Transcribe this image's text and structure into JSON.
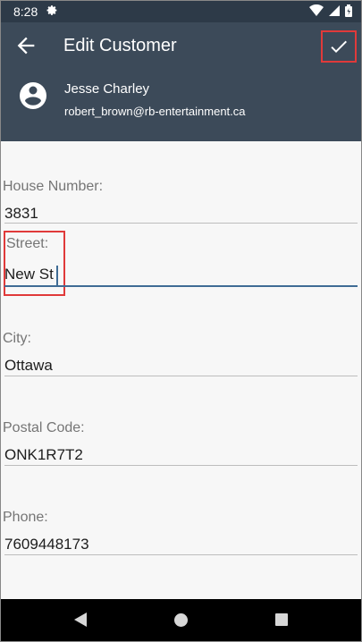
{
  "status_bar": {
    "time": "8:28"
  },
  "toolbar": {
    "title": "Edit Customer",
    "back_icon": "arrow-left-icon",
    "confirm_icon": "check-icon"
  },
  "customer": {
    "name": "Jesse Charley",
    "email": "robert_brown@rb-entertainment.ca",
    "avatar_icon": "account-circle-icon"
  },
  "form": {
    "fields": [
      {
        "label": "House Number:",
        "value": "3831"
      },
      {
        "label": "Street:",
        "value": "New St"
      },
      {
        "label": "City:",
        "value": "Ottawa"
      },
      {
        "label": "Postal Code:",
        "value": "ONK1R7T2"
      },
      {
        "label": "Phone:",
        "value": "7609448173"
      }
    ]
  },
  "colors": {
    "status_bar": "#2d3a48",
    "toolbar": "#3c4a59",
    "accent": "#3f6c95",
    "highlight": "#e03a3a"
  }
}
